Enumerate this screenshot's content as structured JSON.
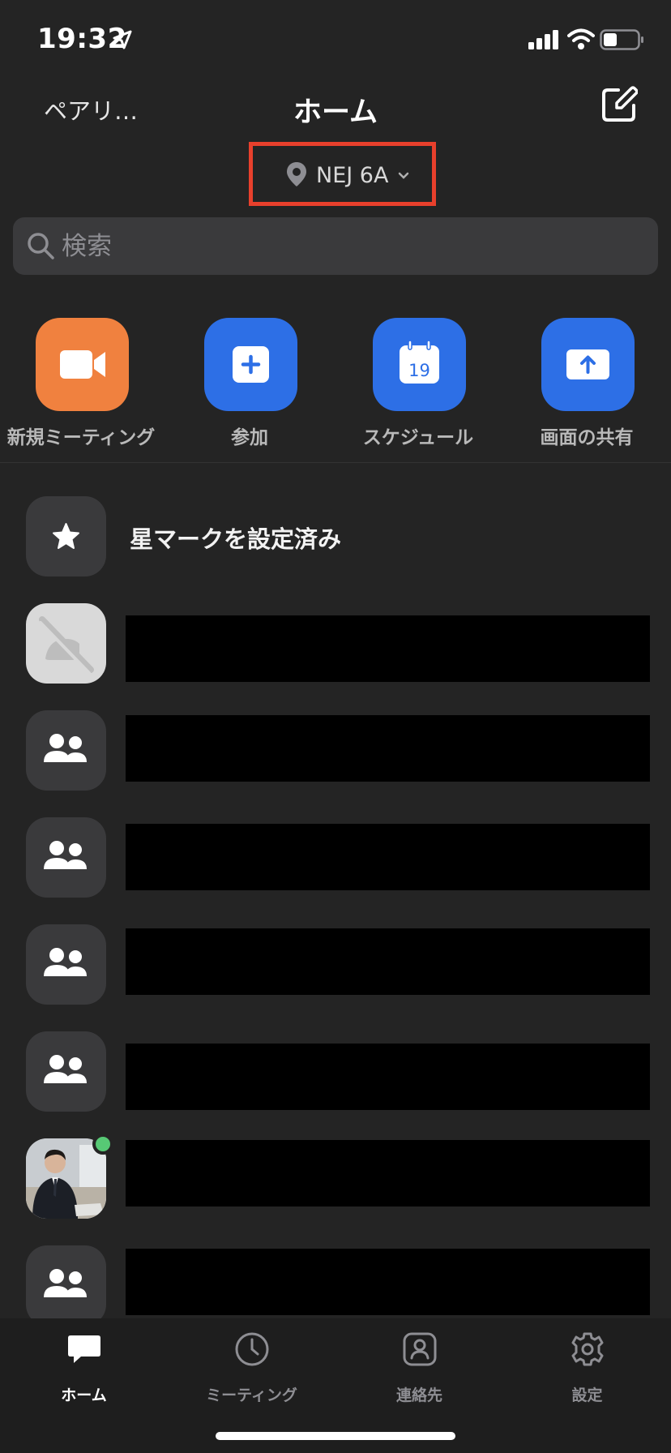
{
  "status_bar": {
    "time": "19:32"
  },
  "header": {
    "left_label": "ペアリ…",
    "title": "ホーム"
  },
  "location": {
    "name": "NEJ 6A"
  },
  "search": {
    "placeholder": "検索"
  },
  "actions": [
    {
      "label": "新規ミーティング",
      "color": "#f0813f",
      "icon": "video-camera-icon"
    },
    {
      "label": "参加",
      "color": "#2d6fe6",
      "icon": "plus-icon"
    },
    {
      "label": "スケジュール",
      "color": "#2d6fe6",
      "icon": "calendar-icon",
      "calendar_day": "19"
    },
    {
      "label": "画面の共有",
      "color": "#2d6fe6",
      "icon": "share-screen-icon"
    }
  ],
  "list": {
    "starred_label": "星マークを設定済み",
    "rows": [
      "unknown-user",
      "group",
      "group",
      "group",
      "group",
      "user-online",
      "group"
    ]
  },
  "tabs": [
    {
      "label": "ホーム",
      "icon": "chat-bubble-icon",
      "active": true
    },
    {
      "label": "ミーティング",
      "icon": "clock-icon",
      "active": false
    },
    {
      "label": "連絡先",
      "icon": "contacts-icon",
      "active": false
    },
    {
      "label": "設定",
      "icon": "gear-icon",
      "active": false
    }
  ],
  "colors": {
    "accent_blue": "#2d6fe6",
    "accent_orange": "#f0813f",
    "highlight_red": "#e8402c",
    "online_green": "#57c975"
  }
}
